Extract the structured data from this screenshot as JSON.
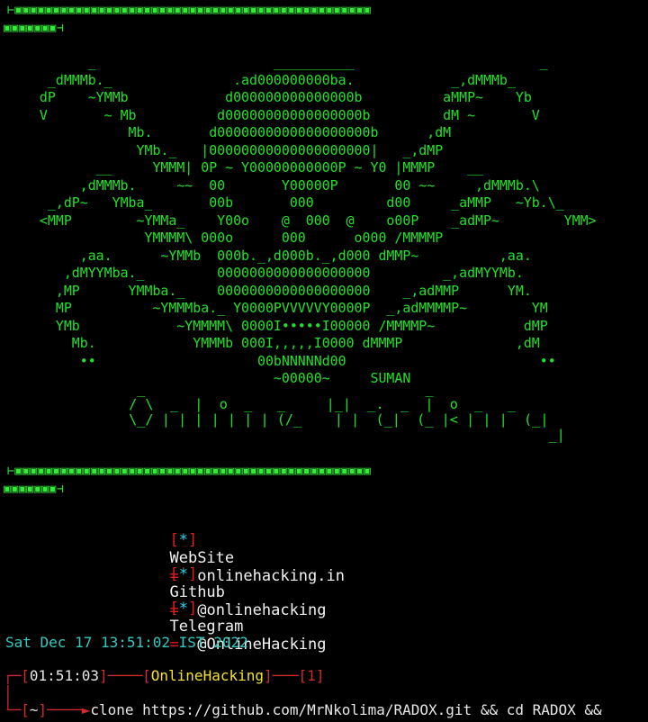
{
  "banner_top_1": "⊢▣▣▣▣▣▣▣▣▣▣▣▣▣▣▣▣▣▣▣▣▣▣▣▣▣▣▣▣▣▣▣▣▣▣▣▣▣▣▣▣▣▣▣▣▣▣▣",
  "banner_top_2": "▣▣▣▣▣▣▣⊣",
  "ascii_art": "        _                      __________                       _\n   _dMMMb._               .ad000000000ba.            _,dMMMb_\n  dP    ~YMMb            d000000000000000b          aMMP~    Yb\n  V       ~ Mb          d00000000000000000b         dM ~       V\n             Mb.       d0000000000000000000b      ,dM\n              YMb._   |00000000000000000000|   _,dMP\n         __     YMMM| 0P ~ Y00000000000P ~ Y0 |MMMP    __\n       ,dMMMb.     ~~  00       Y00000P       00 ~~     ,dMMMb.\\\n   _,dP~   YMba_       00b       000         d00     _aMMP   ~Yb.\\_\n  <MMP        ~YMMa_    Y00o    @  000  @    o00P    _adMP~        YMM>\n               YMMMM\\ 000o      000      o000 /MMMMP\n       ,aa.      ~YMMb  000b._,d000b._,d000 dMMP~          ,aa.\n     ,dMYYMba._         0000000000000000000         _,adMYYMb.\n    ,MP      YMMba._    0000000000000000000    _,adMMP      YM.\n    MP          ~YMMMba._ Y0000PVVVVVY0000P  _,adMMMMP~        YM\n    YMb            ~YMMMM\\ 0000I•••••I00000 /MMMMP~           dMP\n      Mb.            YMMMb 000I,,,,,I0000 dMMMP              ,dM\n       ••                    00bNNNNNd00                        ••\n                               ~00000~     SUMAN",
  "ascii_title": "  _                                  _\n / \\  _  |  o  _   _     |_|  _.  _  |  o  _   _\n \\_/ | | | | | | | (/_    | |  (_|  (_ |< | | |  (_|\n                                                    _|",
  "banner_mid_1": "⊢▣▣▣▣▣▣▣▣▣▣▣▣▣▣▣▣▣▣▣▣▣▣▣▣▣▣▣▣▣▣▣▣▣▣▣▣▣▣▣▣▣▣▣▣▣▣▣",
  "banner_mid_2": "▣▣▣▣▣▣▣⊣",
  "info": [
    {
      "bullet": "*",
      "label": "WebSite ",
      "eq": "=",
      "value": "onlinehacking.in"
    },
    {
      "bullet": "*",
      "label": "Github  ",
      "eq": "=",
      "value": "@onlinehacking"
    },
    {
      "bullet": "*",
      "label": "Telegram",
      "eq": "=",
      "value": "@OnlineHacking"
    }
  ],
  "date_line": "Sat Dec 17 13:51:02 IST 2022",
  "prompt": {
    "time": "01:51:03",
    "user": "OnlineHacking",
    "status": "1",
    "cwd": "~",
    "command": "clone https://github.com/MrNkolima/RADOX.git && cd RADOX &&"
  },
  "colors": {
    "accent_green": "#22e02a",
    "prompt_red": "#d42a2a",
    "highlight_yellow": "#f3e02f",
    "date_cyan": "#33c9c0"
  }
}
